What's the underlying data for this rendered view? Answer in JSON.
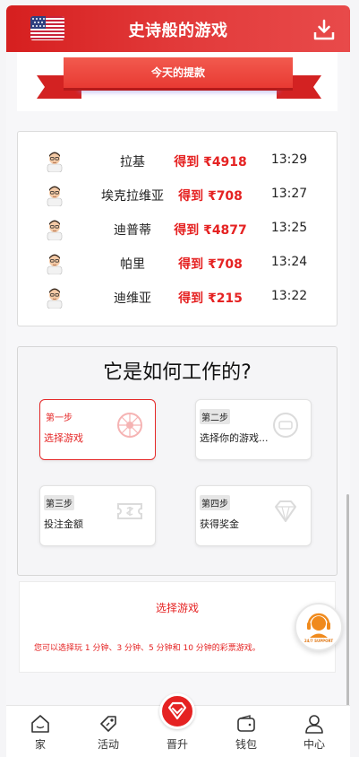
{
  "header": {
    "title": "史诗般的游戏",
    "flag_icon": "us-flag-icon",
    "download_icon": "download-icon"
  },
  "banner": {
    "label": "今天的提款"
  },
  "withdrawals": [
    {
      "name": "拉基",
      "amount": "得到 ₹4918",
      "time": "13:29"
    },
    {
      "name": "埃克拉维亚",
      "amount": "得到 ₹708",
      "time": "13:27"
    },
    {
      "name": "迪普蒂",
      "amount": "得到 ₹4877",
      "time": "13:25"
    },
    {
      "name": "帕里",
      "amount": "得到 ₹708",
      "time": "13:24"
    },
    {
      "name": "迪维亚",
      "amount": "得到 ₹215",
      "time": "13:22"
    }
  ],
  "how": {
    "title": "它是如何工作的?",
    "steps": [
      {
        "badge": "第一步",
        "label": "选择游戏",
        "icon": "wheel-icon"
      },
      {
        "badge": "第二步",
        "label": "选择你的游戏...",
        "icon": "timer-icon"
      },
      {
        "badge": "第三步",
        "label": "投注金额",
        "icon": "ticket-icon"
      },
      {
        "badge": "第四步",
        "label": "获得奖金",
        "icon": "diamond-icon"
      }
    ]
  },
  "description": {
    "title": "选择游戏",
    "text": "您可以选择玩 1 分钟、3 分钟、5 分钟和 10 分钟的彩票游戏。"
  },
  "support": {
    "label": "24/7 SUPPORT"
  },
  "tabs": [
    {
      "label": "家",
      "icon": "home-icon"
    },
    {
      "label": "活动",
      "icon": "tag-icon"
    },
    {
      "label": "晋升",
      "icon": "diamond-icon"
    },
    {
      "label": "钱包",
      "icon": "wallet-icon"
    },
    {
      "label": "中心",
      "icon": "user-icon"
    }
  ],
  "colors": {
    "accent": "#e52222",
    "header_start": "#d61f1f",
    "header_end": "#e84a4a"
  }
}
